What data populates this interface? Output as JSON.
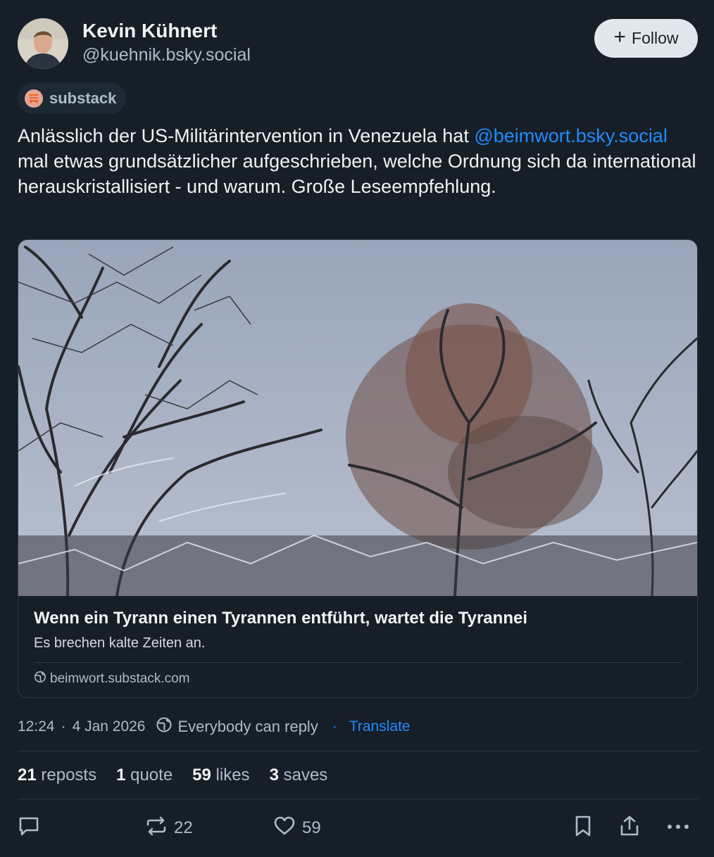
{
  "author": {
    "display_name": "Kevin Kühnert",
    "handle": "@kuehnik.bsky.social"
  },
  "follow_button": {
    "label": "Follow"
  },
  "label_chip": {
    "text": "substack"
  },
  "post": {
    "text_before": "Anlässlich der US-Militärintervention in Venezuela hat ",
    "mention": "@beimwort.bsky.social",
    "text_after": " mal etwas grundsätzlicher aufgeschrieben, welche Ordnung sich da international herauskristallisiert - und warum. Große Leseempfehlung."
  },
  "embed": {
    "title": "Wenn ein Tyrann einen Tyrannen entführt, wartet die Tyrannei",
    "description": "Es brechen kalte Zeiten an.",
    "domain": "beimwort.substack.com"
  },
  "meta": {
    "time": "12:24",
    "date": "4 Jan 2026",
    "separator": "·",
    "reply_setting": "Everybody can reply",
    "translate": "Translate"
  },
  "stats": {
    "reposts_count": "21",
    "reposts_label": "reposts",
    "quotes_count": "1",
    "quotes_label": "quote",
    "likes_count": "59",
    "likes_label": "likes",
    "saves_count": "3",
    "saves_label": "saves"
  },
  "actions": {
    "repost_count": "22",
    "like_count": "59"
  },
  "colors": {
    "background": "#161e27",
    "accent": "#208bfe",
    "muted": "#aebbc9",
    "border": "#2e3a48"
  },
  "icons": [
    "plus-icon",
    "substack-logo-icon",
    "globe-icon",
    "reply-setting-icon",
    "reply-icon",
    "repost-icon",
    "like-icon",
    "bookmark-icon",
    "share-icon",
    "more-icon"
  ]
}
